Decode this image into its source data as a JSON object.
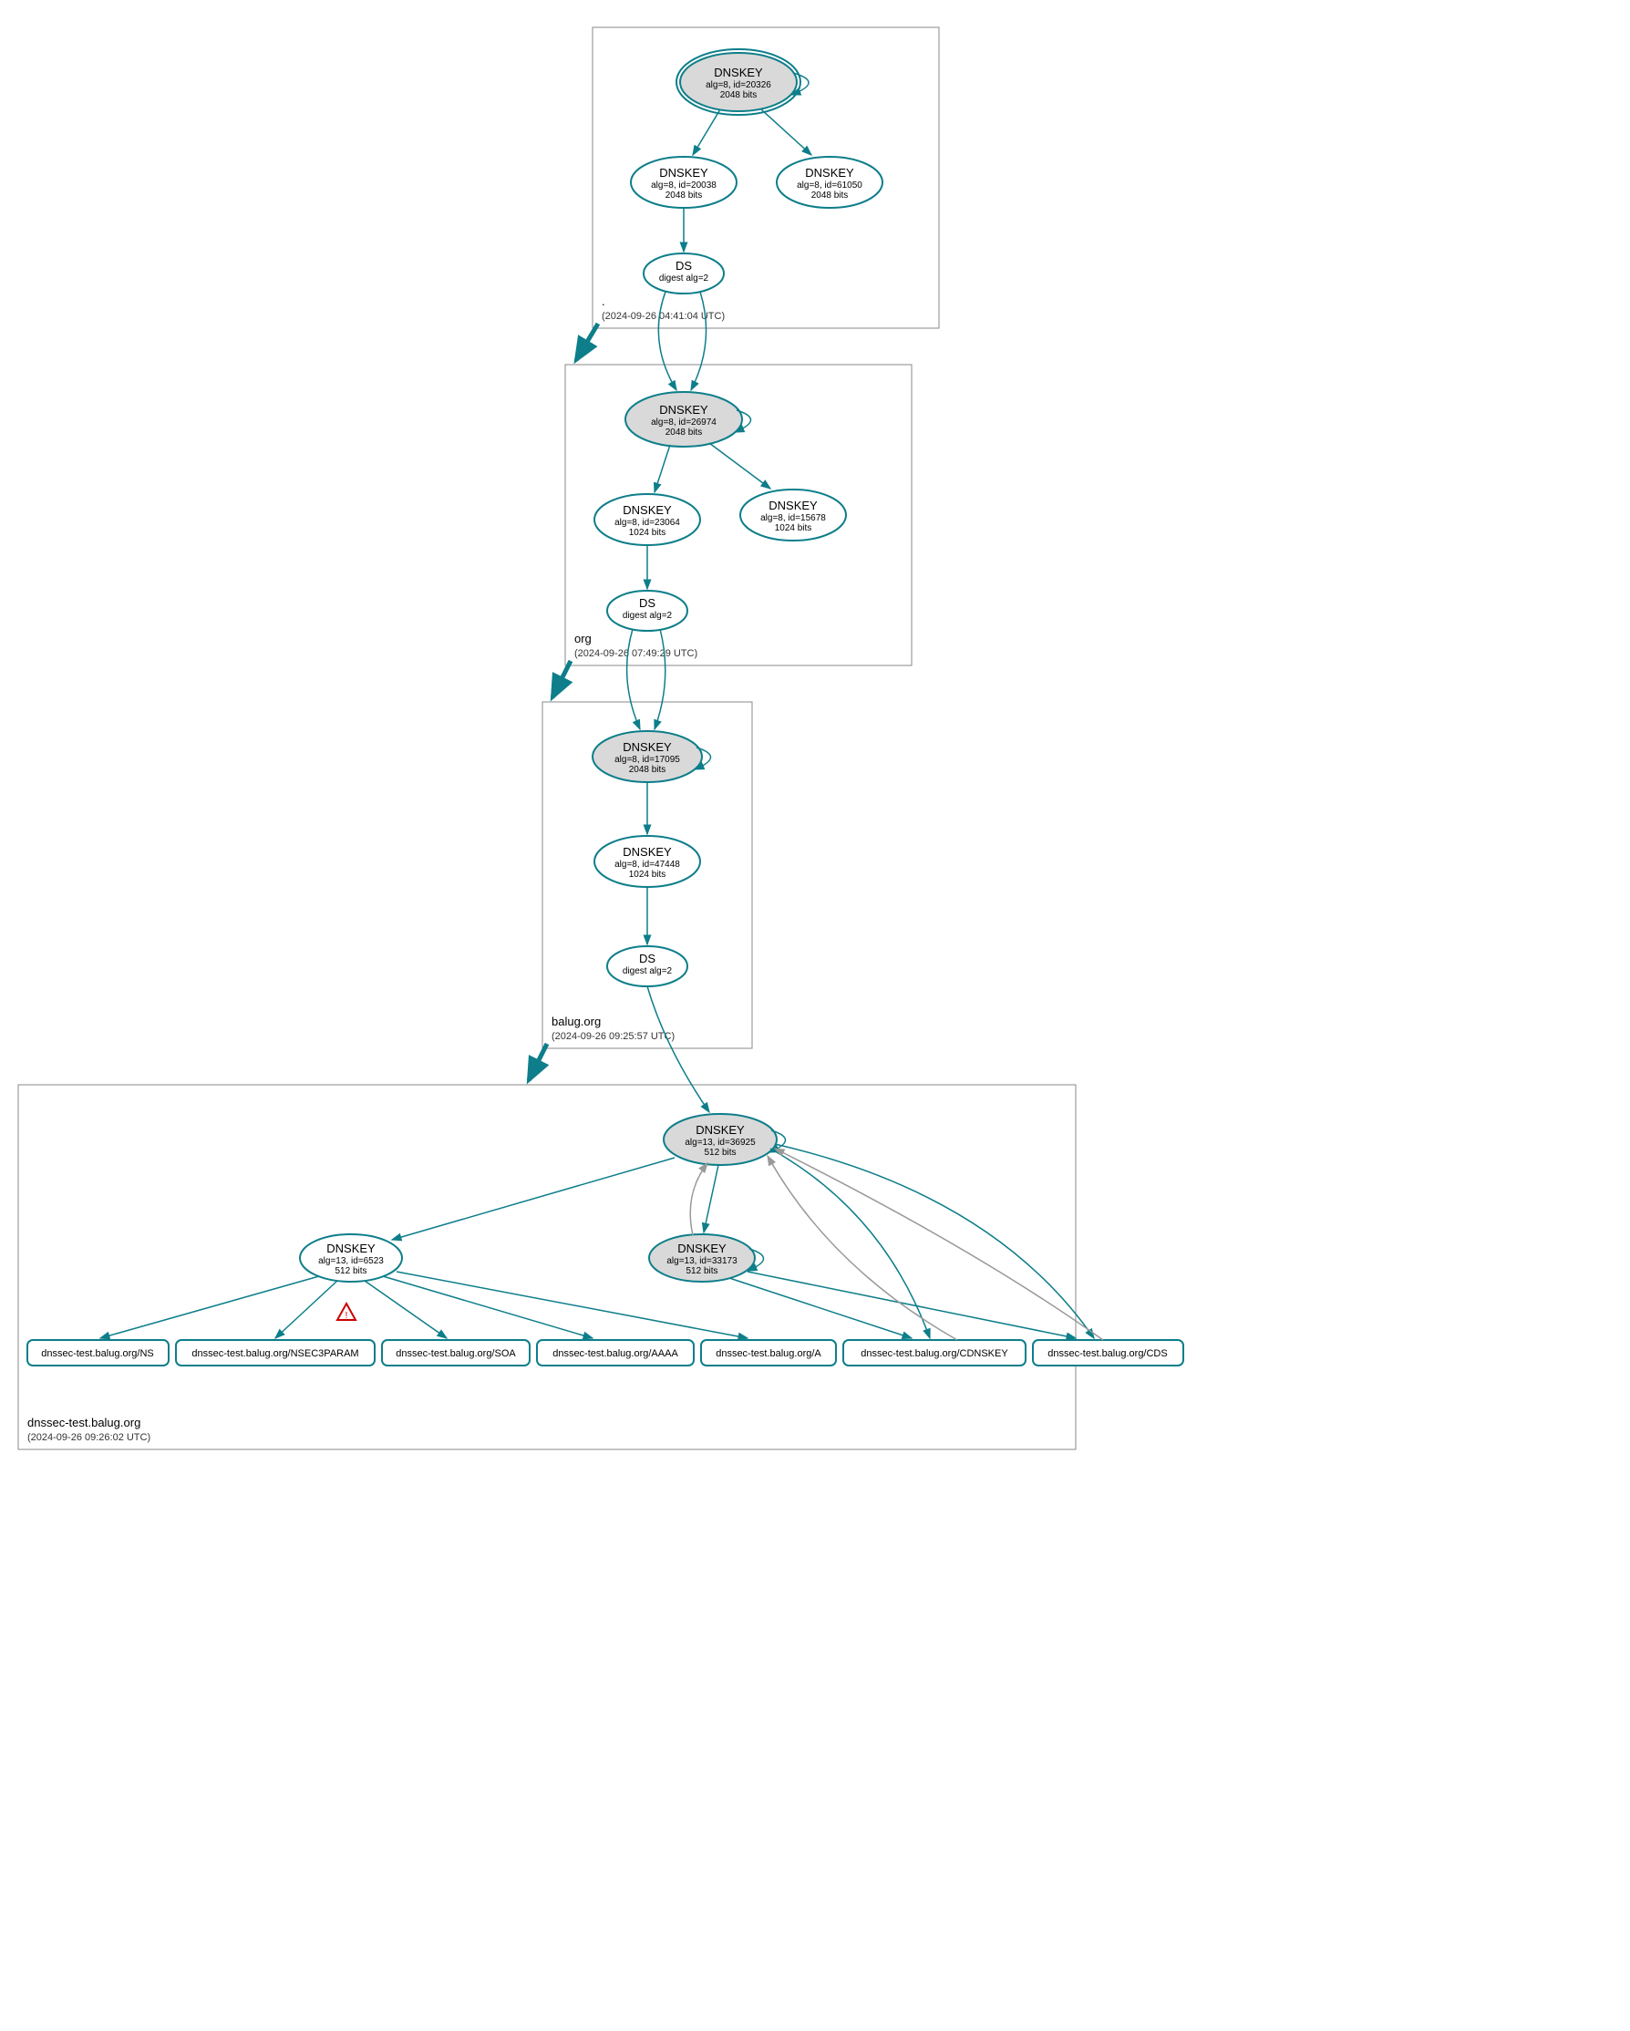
{
  "colors": {
    "stroke": "#0d7e8a",
    "ksk_fill": "#d9d9d9",
    "warn": "#c00"
  },
  "zones": [
    {
      "id": "root",
      "label": ".",
      "timestamp": "(2024-09-26 04:41:04 UTC)"
    },
    {
      "id": "org",
      "label": "org",
      "timestamp": "(2024-09-26 07:49:29 UTC)"
    },
    {
      "id": "balug",
      "label": "balug.org",
      "timestamp": "(2024-09-26 09:25:57 UTC)"
    },
    {
      "id": "dnssec-test",
      "label": "dnssec-test.balug.org",
      "timestamp": "(2024-09-26 09:26:02 UTC)"
    }
  ],
  "nodes": {
    "root_ksk": {
      "title": "DNSKEY",
      "line1": "alg=8, id=20326",
      "line2": "2048 bits"
    },
    "root_zsk1": {
      "title": "DNSKEY",
      "line1": "alg=8, id=20038",
      "line2": "2048 bits"
    },
    "root_zsk2": {
      "title": "DNSKEY",
      "line1": "alg=8, id=61050",
      "line2": "2048 bits"
    },
    "root_ds": {
      "title": "DS",
      "line1": "digest alg=2"
    },
    "org_ksk": {
      "title": "DNSKEY",
      "line1": "alg=8, id=26974",
      "line2": "2048 bits"
    },
    "org_zsk1": {
      "title": "DNSKEY",
      "line1": "alg=8, id=23064",
      "line2": "1024 bits"
    },
    "org_zsk2": {
      "title": "DNSKEY",
      "line1": "alg=8, id=15678",
      "line2": "1024 bits"
    },
    "org_ds": {
      "title": "DS",
      "line1": "digest alg=2"
    },
    "balug_ksk": {
      "title": "DNSKEY",
      "line1": "alg=8, id=17095",
      "line2": "2048 bits"
    },
    "balug_zsk": {
      "title": "DNSKEY",
      "line1": "alg=8, id=47448",
      "line2": "1024 bits"
    },
    "balug_ds": {
      "title": "DS",
      "line1": "digest alg=2"
    },
    "dt_ksk": {
      "title": "DNSKEY",
      "line1": "alg=13, id=36925",
      "line2": "512 bits"
    },
    "dt_zsk": {
      "title": "DNSKEY",
      "line1": "alg=13, id=6523",
      "line2": "512 bits"
    },
    "dt_zsk2": {
      "title": "DNSKEY",
      "line1": "alg=13, id=33173",
      "line2": "512 bits"
    }
  },
  "rrsets": [
    {
      "id": "rr_ns",
      "label": "dnssec-test.balug.org/NS"
    },
    {
      "id": "rr_nsec3param",
      "label": "dnssec-test.balug.org/NSEC3PARAM"
    },
    {
      "id": "rr_soa",
      "label": "dnssec-test.balug.org/SOA"
    },
    {
      "id": "rr_aaaa",
      "label": "dnssec-test.balug.org/AAAA"
    },
    {
      "id": "rr_a",
      "label": "dnssec-test.balug.org/A"
    },
    {
      "id": "rr_cdnskey",
      "label": "dnssec-test.balug.org/CDNSKEY"
    },
    {
      "id": "rr_cds",
      "label": "dnssec-test.balug.org/CDS"
    }
  ],
  "edges_description": "KSK signs ZSKs and self, ZSK signs DS, DS chains to child KSK"
}
